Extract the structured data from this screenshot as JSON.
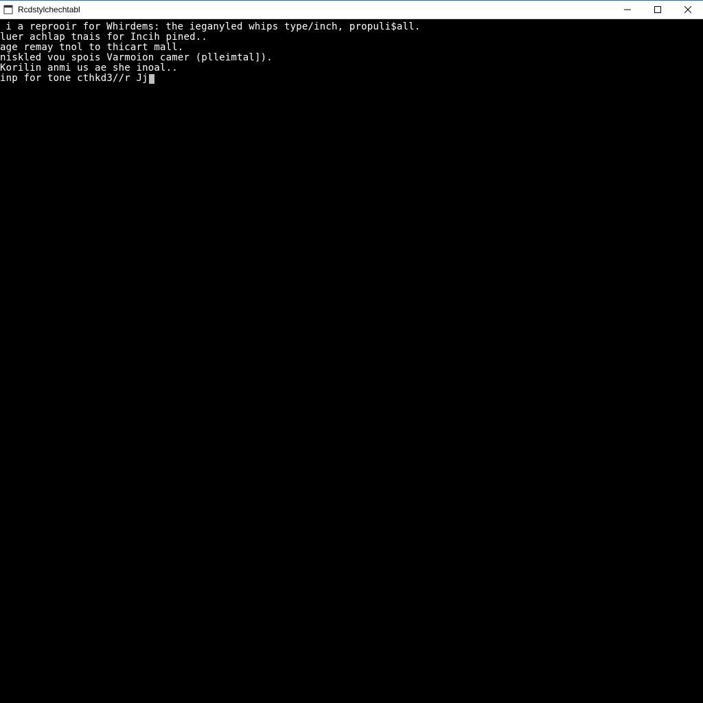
{
  "titlebar": {
    "title": "Rcdstylchechtabl"
  },
  "console": {
    "lines": [
      "￼i a reprooir for Whirdems: the ieganyled whips type/inch, propuli$all.",
      "luer achlap tnais for Incih pined..",
      "",
      "age remay tnol to thicart mall.",
      "niskled vou spois Varmoion camer (plleimtal]).",
      "Korilin anmi us ae she inoal..",
      "inp for tone cthkd3//r Jj"
    ]
  }
}
